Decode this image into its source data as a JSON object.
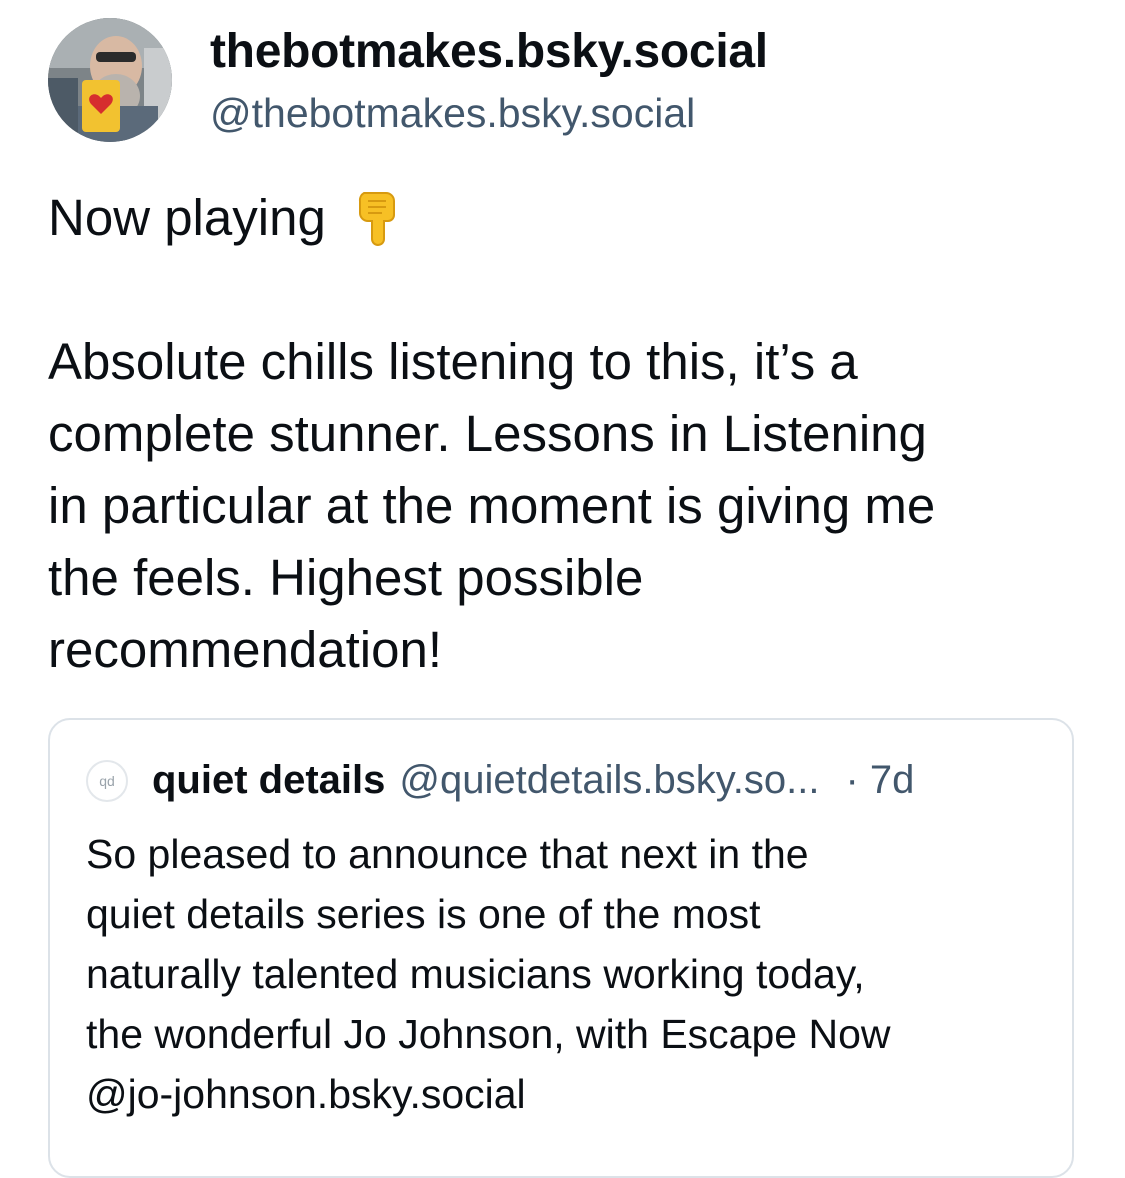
{
  "post": {
    "author_display_name": "thebotmakes.bsky.social",
    "author_handle": "@thebotmakes.bsky.social",
    "now_playing": "Now playing",
    "emoji_icon": "backhand-index-pointing-down-icon",
    "text_lines": [
      "Absolute chills listening to this, it’s a",
      "complete stunner.  Lessons in Listening",
      "in particular at the moment is giving me",
      "the feels.  Highest possible",
      "recommendation!"
    ]
  },
  "quote": {
    "avatar_text": "qd",
    "display_name": "quiet details",
    "handle": "@quietdetails.bsky.so...",
    "time": "· 7d",
    "text_lines": [
      "So pleased to announce that next in the",
      "quiet details series is one of the most",
      "naturally talented musicians working today,",
      "the wonderful Jo Johnson, with Escape Now",
      "@jo-johnson.bsky.social"
    ]
  },
  "colors": {
    "text_primary": "#0b0f14",
    "text_secondary": "#42576c",
    "card_border": "#dce2e8"
  }
}
